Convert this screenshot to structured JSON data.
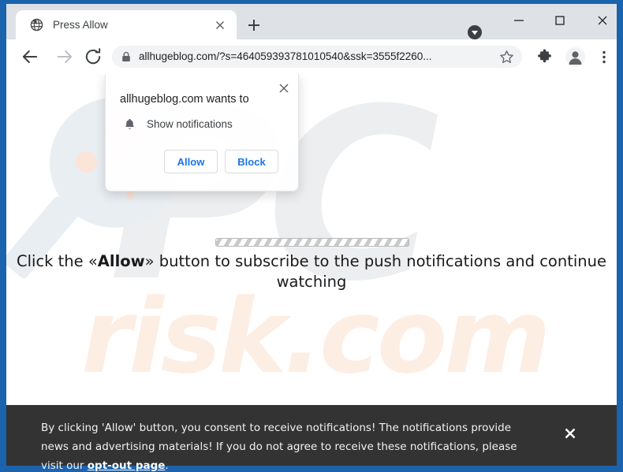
{
  "browser": {
    "window_title": "Press Allow",
    "tab": {
      "title": "Press Allow",
      "favicon": "globe-icon",
      "close_label": "×"
    },
    "new_tab_label": "+",
    "window_controls": {
      "tab_search": "tab-search-icon",
      "minimize": "–",
      "maximize": "□",
      "close": "✕"
    },
    "nav": {
      "back": "back-arrow-icon",
      "forward": "forward-arrow-icon",
      "reload": "reload-icon"
    },
    "omnibox": {
      "url": "allhugeblog.com/?s=464059393781010540&ssk=3555f2260...",
      "lock_icon": "lock-icon",
      "star_icon": "bookmark-star-icon"
    },
    "toolbar_icons": {
      "extensions": "puzzle-piece-icon",
      "profile": "profile-avatar-icon",
      "menu": "three-dot-menu-icon"
    }
  },
  "permission_dialog": {
    "title": "allhugeblog.com wants to",
    "permission_icon": "bell-icon",
    "permission_label": "Show notifications",
    "allow_label": "Allow",
    "block_label": "Block",
    "close_label": "✕",
    "accent_color": "#1a73e8"
  },
  "page": {
    "instruction_prefix": "Click the «",
    "instruction_bold": "Allow",
    "instruction_suffix": "» button to subscribe to the push notifications and continue watching",
    "progress_bar": "striped-progress-bar",
    "watermark_pc": "PC",
    "watermark_risk": "risk.com"
  },
  "consent_banner": {
    "text_before_link": "By clicking 'Allow' button, you consent to receive notifications! The notifications provide news and advertising materials! If you do not agree to receive these notifications, please visit our ",
    "link_label": "opt-out page",
    "text_after_link": ".",
    "close_label": "✕",
    "background_color": "#333333"
  },
  "colors": {
    "window_frame": "#1b63ad",
    "tab_strip": "#dee1e6",
    "omnibox": "#f1f3f4",
    "link_blue": "#1a73e8"
  }
}
